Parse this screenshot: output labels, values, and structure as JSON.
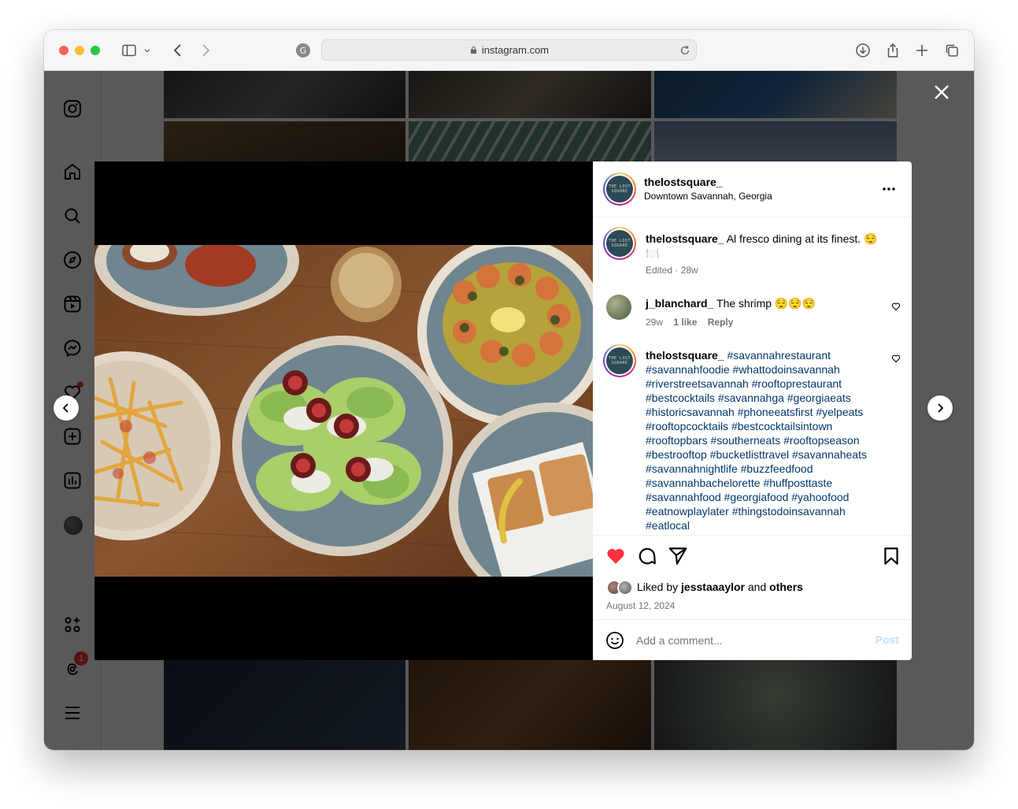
{
  "browser": {
    "url": "instagram.com",
    "traffic_colors": [
      "#ff5f57",
      "#febc2e",
      "#28c840"
    ]
  },
  "sidebar": {
    "icons": [
      "instagram-logo-icon",
      "home-icon",
      "search-icon",
      "explore-icon",
      "reels-icon",
      "messenger-icon",
      "notifications-icon",
      "create-icon",
      "dashboard-icon",
      "profile-avatar",
      "more-apps-icon",
      "threads-icon",
      "menu-icon"
    ],
    "threads_badge": "1"
  },
  "post": {
    "username": "thelostsquare_",
    "location": "Downtown Savannah, Georgia",
    "logo_text": "THE LOST SQUARE",
    "caption": {
      "username": "thelostsquare_",
      "text": "Al fresco dining at its finest. 😌🍽️",
      "meta": "Edited · 28w"
    },
    "comments": [
      {
        "username": "j_blanchard_",
        "text": "The shrimp 😌😌😌",
        "time": "29w",
        "likes": "1 like",
        "reply": "Reply"
      },
      {
        "username": "thelostsquare_",
        "hashtags": "#savannahrestaurant #savannahfoodie #whattodoinsavannah #riverstreetsavannah #rooftoprestaurant #bestcocktails #savannahga #georgiaeats #historicsavannah #phoneeatsfirst #yelpeats #rooftopcocktails #bestcocktailsintown #rooftopbars #southerneats #rooftopseason #bestrooftop #bucketlisttravel #savannaheats #savannahnightlife #buzzfeedfood #savannahbachelorette #huffposttaste #savannahfood #georgiafood #yahoofood #eatnowplaylater #thingstodoinsavannah #eatlocal"
      }
    ],
    "liked_by_prefix": "Liked by",
    "liked_by_user": "jesstaaaylor",
    "liked_by_and": "and",
    "liked_by_others": "others",
    "date": "August 12, 2024",
    "comment_placeholder": "Add a comment...",
    "post_button": "Post",
    "like_color": "#ff3040"
  }
}
